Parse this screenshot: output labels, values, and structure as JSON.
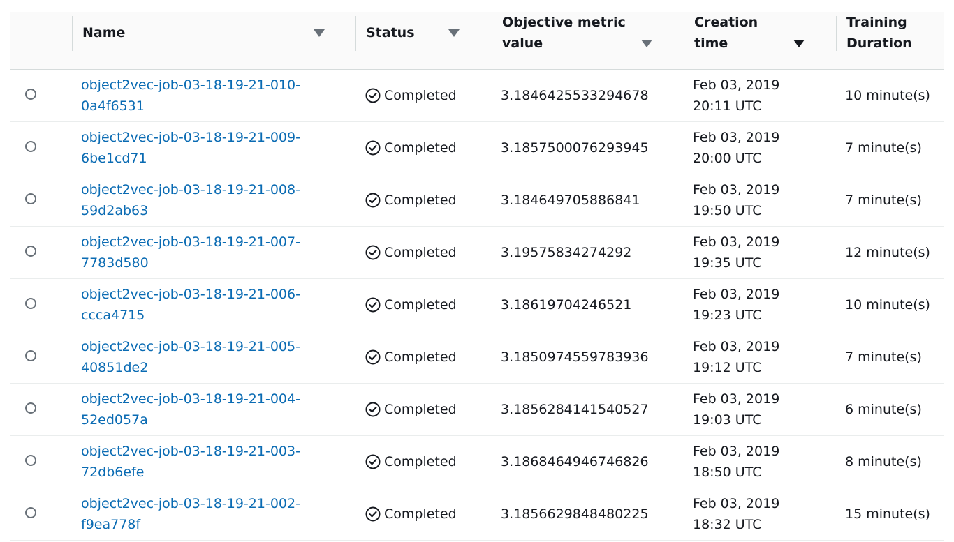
{
  "table": {
    "columns": {
      "name": "Name",
      "status": "Status",
      "objective_line1": "Objective metric",
      "objective_line2": "value",
      "creation_line1": "Creation",
      "creation_line2": "time",
      "duration_line1": "Training",
      "duration_line2": "Duration"
    },
    "sort_column": "Creation time",
    "rows": [
      {
        "name_line1": "object2vec-job-03-18-19-21-010-",
        "name_line2": "0a4f6531",
        "status": "Completed",
        "objective": "3.1846425533294678",
        "date": "Feb 03, 2019",
        "time": "20:11 UTC",
        "duration": "10 minute(s)"
      },
      {
        "name_line1": "object2vec-job-03-18-19-21-009-",
        "name_line2": "6be1cd71",
        "status": "Completed",
        "objective": "3.1857500076293945",
        "date": "Feb 03, 2019",
        "time": "20:00 UTC",
        "duration": "7 minute(s)"
      },
      {
        "name_line1": "object2vec-job-03-18-19-21-008-",
        "name_line2": "59d2ab63",
        "status": "Completed",
        "objective": "3.184649705886841",
        "date": "Feb 03, 2019",
        "time": "19:50 UTC",
        "duration": "7 minute(s)"
      },
      {
        "name_line1": "object2vec-job-03-18-19-21-007-",
        "name_line2": "7783d580",
        "status": "Completed",
        "objective": "3.19575834274292",
        "date": "Feb 03, 2019",
        "time": "19:35 UTC",
        "duration": "12 minute(s)"
      },
      {
        "name_line1": "object2vec-job-03-18-19-21-006-",
        "name_line2": "ccca4715",
        "status": "Completed",
        "objective": "3.18619704246521",
        "date": "Feb 03, 2019",
        "time": "19:23 UTC",
        "duration": "10 minute(s)"
      },
      {
        "name_line1": "object2vec-job-03-18-19-21-005-",
        "name_line2": "40851de2",
        "status": "Completed",
        "objective": "3.1850974559783936",
        "date": "Feb 03, 2019",
        "time": "19:12 UTC",
        "duration": "7 minute(s)"
      },
      {
        "name_line1": "object2vec-job-03-18-19-21-004-",
        "name_line2": "52ed057a",
        "status": "Completed",
        "objective": "3.1856284141540527",
        "date": "Feb 03, 2019",
        "time": "19:03 UTC",
        "duration": "6 minute(s)"
      },
      {
        "name_line1": "object2vec-job-03-18-19-21-003-",
        "name_line2": "72db6efe",
        "status": "Completed",
        "objective": "3.1868464946746826",
        "date": "Feb 03, 2019",
        "time": "18:50 UTC",
        "duration": "8 minute(s)"
      },
      {
        "name_line1": "object2vec-job-03-18-19-21-002-",
        "name_line2": "f9ea778f",
        "status": "Completed",
        "objective": "3.1856629848480225",
        "date": "Feb 03, 2019",
        "time": "18:32 UTC",
        "duration": "15 minute(s)"
      }
    ]
  },
  "icons": {
    "status": "check-circle-icon",
    "sort": "caret-down-icon",
    "select": "radio-button-icon"
  },
  "colors": {
    "link": "#0a6bb3",
    "header_bg": "#fafafa",
    "success_icon": "#16191f"
  }
}
